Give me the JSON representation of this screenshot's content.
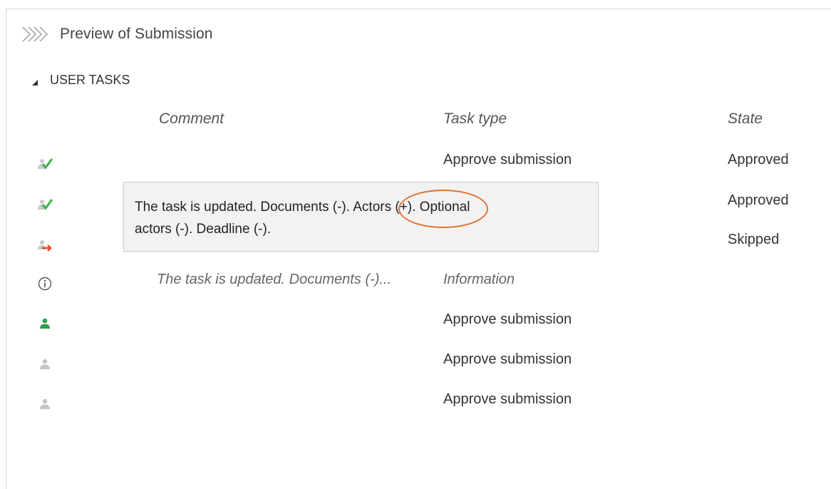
{
  "panel": {
    "title": "Preview of Submission",
    "header_icon": "double-chevron-right-icon"
  },
  "section": {
    "label": "USER TASKS",
    "expanded": true
  },
  "columns": {
    "comment": "Comment",
    "task_type": "Task type",
    "state": "State"
  },
  "rows": [
    {
      "icon": "user-check-icon",
      "comment": "",
      "task_type": "Approve submission",
      "state": "Approved"
    },
    {
      "icon": "user-check-icon",
      "comment": "",
      "task_type": "",
      "state": "Approved"
    },
    {
      "icon": "user-forward-icon",
      "comment": "",
      "task_type": "",
      "state": "Skipped"
    },
    {
      "icon": "info-icon",
      "comment": "The task is updated. Documents (-)...",
      "task_type": "Information",
      "state": ""
    },
    {
      "icon": "user-active-icon",
      "comment": "",
      "task_type": "Approve submission",
      "state": ""
    },
    {
      "icon": "user-inactive-icon",
      "comment": "",
      "task_type": "Approve submission",
      "state": ""
    },
    {
      "icon": "user-inactive-icon",
      "comment": "",
      "task_type": "Approve submission",
      "state": ""
    }
  ],
  "tooltip": {
    "line1": "The task is updated. Documents (-). Actors (+). Optional",
    "line2": "actors (-). Deadline (-).",
    "highlight": "Actors (+)."
  },
  "colors": {
    "check_green": "#3cae4a",
    "user_green": "#2e9e4b",
    "user_grey": "#c4c4c4",
    "arrow_red": "#e2502b",
    "highlight_orange": "#e07433"
  }
}
